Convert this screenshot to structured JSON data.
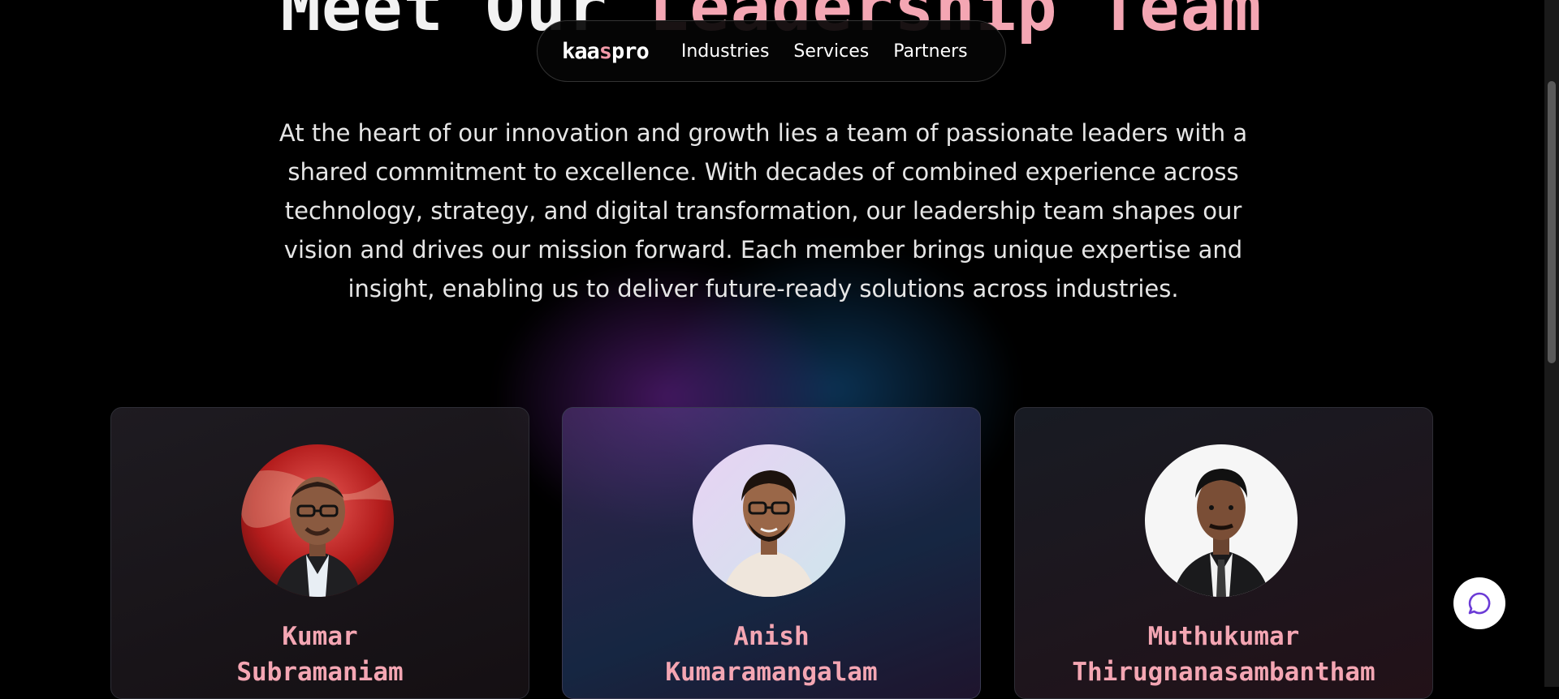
{
  "hero": {
    "title_part1": "Meet Our",
    "title_part2": "Leadership Team"
  },
  "nav": {
    "logo_part1": "kaa",
    "logo_accent": "s",
    "logo_part2": "pro",
    "links": [
      "Industries",
      "Services",
      "Partners"
    ]
  },
  "intro": {
    "text": "At the heart of our innovation and growth lies a team of passionate leaders with a shared commitment to excellence. With decades of combined experience across technology, strategy, and digital transformation, our leadership team shapes our vision and drives our mission forward. Each member brings unique expertise and insight, enabling us to deliver future-ready solutions across industries."
  },
  "leaders": [
    {
      "first": "Kumar",
      "last": "Subramaniam"
    },
    {
      "first": "Anish",
      "last": "Kumaramangalam"
    },
    {
      "first": "Muthukumar",
      "last": "Thirugnanasambantham"
    }
  ],
  "icons": {
    "chat": "chat-bubble-icon",
    "avatar": "person-avatar"
  },
  "colors": {
    "accent_pink": "#f4a6b3",
    "background": "#000000",
    "chat_icon": "#6b3bd6"
  }
}
